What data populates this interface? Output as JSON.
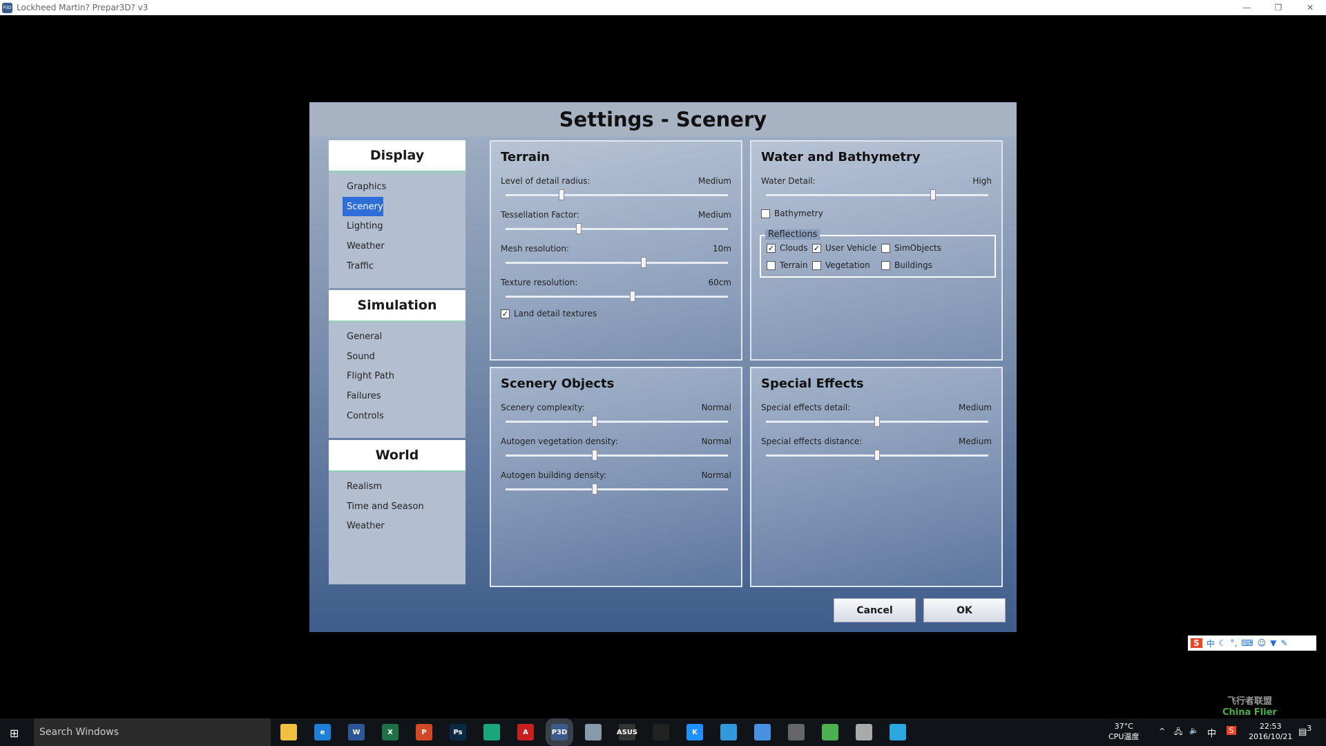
{
  "window": {
    "title": "Lockheed Martin? Prepar3D? v3",
    "app_icon": "P3D"
  },
  "dialog": {
    "title": "Settings - Scenery"
  },
  "nav": [
    {
      "header": "Display",
      "items": [
        "Graphics",
        "Scenery",
        "Lighting",
        "Weather",
        "Traffic"
      ],
      "selected": "Scenery"
    },
    {
      "header": "Simulation",
      "items": [
        "General",
        "Sound",
        "Flight Path",
        "Failures",
        "Controls"
      ]
    },
    {
      "header": "World",
      "items": [
        "Realism",
        "Time and Season",
        "Weather"
      ]
    }
  ],
  "terrain": {
    "title": "Terrain",
    "sliders": [
      {
        "label": "Level of detail radius:",
        "value": "Medium",
        "level": 0.25
      },
      {
        "label": "Tessellation Factor:",
        "value": "Medium",
        "level": 0.33
      },
      {
        "label": "Mesh resolution:",
        "value": "10m",
        "level": 0.62
      },
      {
        "label": "Texture resolution:",
        "value": "60cm",
        "level": 0.57
      }
    ],
    "land_detail": {
      "label": "Land detail textures",
      "checked": true
    }
  },
  "water": {
    "title": "Water and Bathymetry",
    "sliders": [
      {
        "label": "Water Detail:",
        "value": "High",
        "level": 0.75
      }
    ],
    "bathymetry": {
      "label": "Bathymetry",
      "checked": false
    },
    "reflections": {
      "label": "Reflections",
      "items": [
        {
          "label": "Clouds",
          "checked": true
        },
        {
          "label": "User Vehicle",
          "checked": true
        },
        {
          "label": "SimObjects",
          "checked": false
        },
        {
          "label": "Terrain",
          "checked": false
        },
        {
          "label": "Vegetation",
          "checked": false
        },
        {
          "label": "Buildings",
          "checked": false
        }
      ]
    }
  },
  "scenery_objects": {
    "title": "Scenery Objects",
    "sliders": [
      {
        "label": "Scenery complexity:",
        "value": "Normal",
        "level": 0.4
      },
      {
        "label": "Autogen vegetation density:",
        "value": "Normal",
        "level": 0.4
      },
      {
        "label": "Autogen building density:",
        "value": "Normal",
        "level": 0.4
      }
    ]
  },
  "special_effects": {
    "title": "Special Effects",
    "sliders": [
      {
        "label": "Special effects detail:",
        "value": "Medium",
        "level": 0.5
      },
      {
        "label": "Special effects distance:",
        "value": "Medium",
        "level": 0.5
      }
    ]
  },
  "buttons": {
    "cancel": "Cancel",
    "ok": "OK"
  },
  "taskbar": {
    "search_placeholder": "Search Windows",
    "apps": [
      {
        "name": "file-explorer",
        "label": "",
        "color": "#f0c040"
      },
      {
        "name": "edge",
        "label": "e",
        "color": "#1e7fd8"
      },
      {
        "name": "word",
        "label": "W",
        "color": "#2b5797"
      },
      {
        "name": "excel",
        "label": "X",
        "color": "#1e7145"
      },
      {
        "name": "powerpoint",
        "label": "P",
        "color": "#d24726"
      },
      {
        "name": "photoshop",
        "label": "Ps",
        "color": "#0a2a44"
      },
      {
        "name": "app-green",
        "label": "",
        "color": "#1aa67a"
      },
      {
        "name": "acrobat",
        "label": "A",
        "color": "#c81e1e"
      },
      {
        "name": "prepar3d",
        "label": "P3D",
        "color": "#3b5b8f"
      },
      {
        "name": "app-plane",
        "label": "",
        "color": "#8899aa"
      },
      {
        "name": "asus",
        "label": "ASUS",
        "color": "#333"
      },
      {
        "name": "qq",
        "label": "",
        "color": "#222"
      },
      {
        "name": "kugou",
        "label": "K",
        "color": "#1e90ff"
      },
      {
        "name": "app-blue",
        "label": "",
        "color": "#3399dd"
      },
      {
        "name": "app-bird",
        "label": "",
        "color": "#4a90e2"
      },
      {
        "name": "app-globe",
        "label": "",
        "color": "#666"
      },
      {
        "name": "chrome",
        "label": "",
        "color": "#4caf50"
      },
      {
        "name": "app-doc",
        "label": "",
        "color": "#aaa"
      },
      {
        "name": "app-screen",
        "label": "",
        "color": "#29a8e0"
      }
    ],
    "cpu_temp": "37°C",
    "cpu_label": "CPU温度",
    "ime": "中",
    "time": "22:53",
    "date": "2016/10/21",
    "notifications": "3"
  },
  "watermark": {
    "text_cn": "飞行者联盟",
    "text_en": "China Flier"
  },
  "ime_toolbar": {
    "logo": "S",
    "mode": "中"
  }
}
